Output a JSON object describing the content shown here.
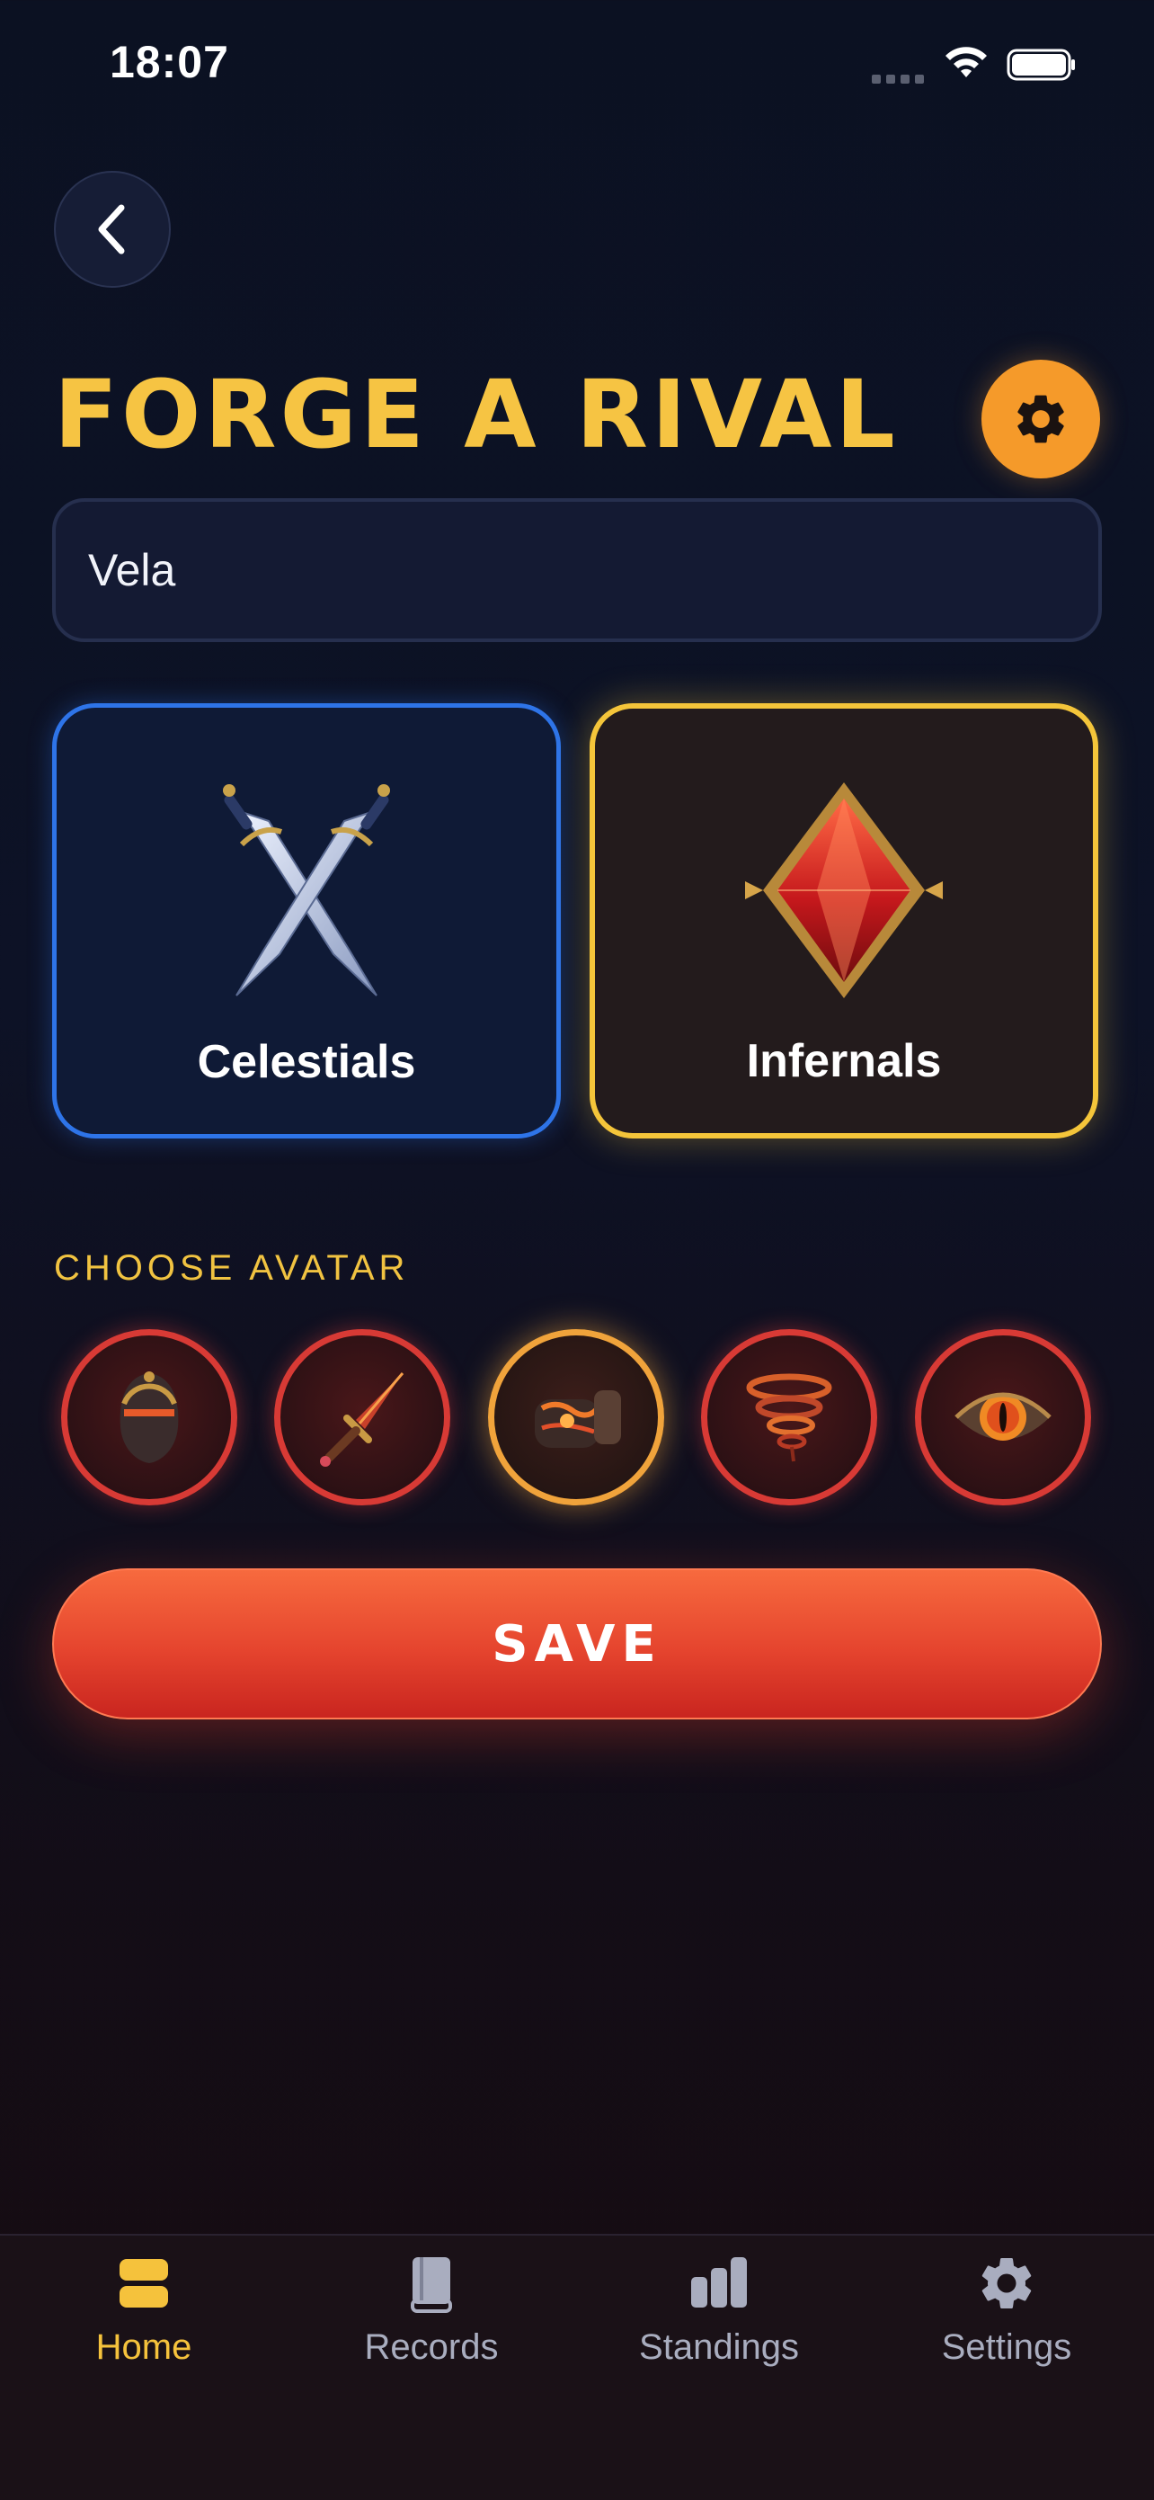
{
  "status_bar": {
    "time": "18:07"
  },
  "header": {
    "title": "FORGE A RIVAL"
  },
  "name_field": {
    "value": "Vela"
  },
  "factions": [
    {
      "label": "Celestials",
      "icon": "crossed-swords-icon",
      "selected": false
    },
    {
      "label": "Infernals",
      "icon": "fire-gem-icon",
      "selected": true
    }
  ],
  "avatar_section": {
    "label": "CHOOSE AVATAR"
  },
  "avatars": [
    {
      "icon": "masked-helmet-icon",
      "selected": false
    },
    {
      "icon": "flame-dagger-icon",
      "selected": false
    },
    {
      "icon": "lava-gauntlet-icon",
      "selected": true
    },
    {
      "icon": "fire-tornado-icon",
      "selected": false
    },
    {
      "icon": "demon-eye-icon",
      "selected": false
    }
  ],
  "actions": {
    "save_label": "SAVE"
  },
  "tabbar": {
    "items": [
      {
        "label": "Home",
        "icon": "home-icon",
        "active": true
      },
      {
        "label": "Records",
        "icon": "book-icon",
        "active": false
      },
      {
        "label": "Standings",
        "icon": "bar-chart-icon",
        "active": false
      },
      {
        "label": "Settings",
        "icon": "gear-icon",
        "active": false
      }
    ]
  },
  "colors": {
    "accent_gold": "#f6c443",
    "accent_orange": "#f59a2a",
    "celestial_blue": "#2e74e8",
    "infernal_red": "#d83a35",
    "save_red": "#e5442e"
  }
}
